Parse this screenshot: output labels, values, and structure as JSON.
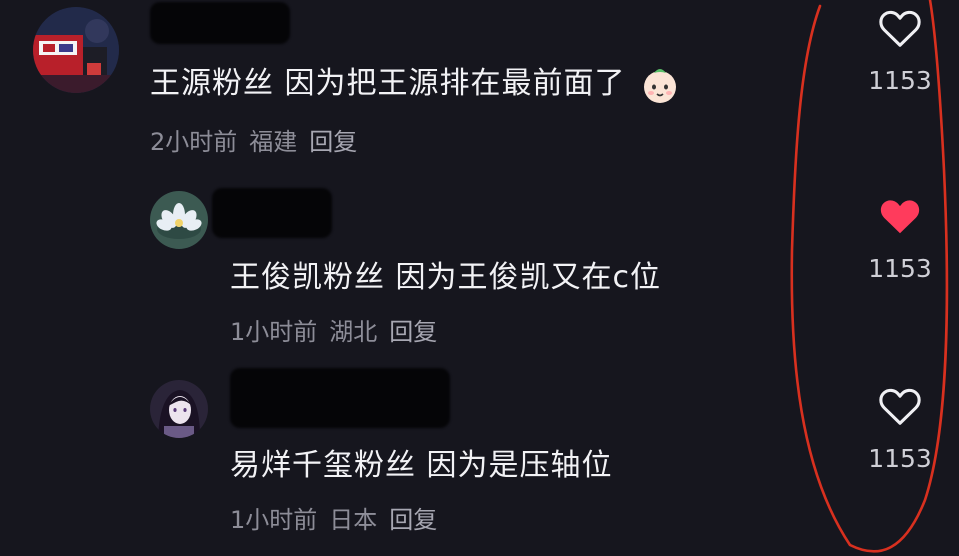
{
  "comments": [
    {
      "text": "王源粉丝 因为把王源排在最前面了",
      "emoji": "baby-face-emoji",
      "time": "2小时前",
      "location": "福建",
      "reply": "回复",
      "likes": "1153",
      "liked": false
    },
    {
      "text": "王俊凯粉丝 因为王俊凯又在c位",
      "time": "1小时前",
      "location": "湖北",
      "reply": "回复",
      "likes": "1153",
      "liked": true
    },
    {
      "text": "易烊千玺粉丝 因为是压轴位",
      "time": "1小时前",
      "location": "日本",
      "reply": "回复",
      "likes": "1153",
      "liked": false
    }
  ],
  "colors": {
    "background": "#16161e",
    "liked_heart": "#ff3b5c",
    "annotation": "#d8301f"
  }
}
